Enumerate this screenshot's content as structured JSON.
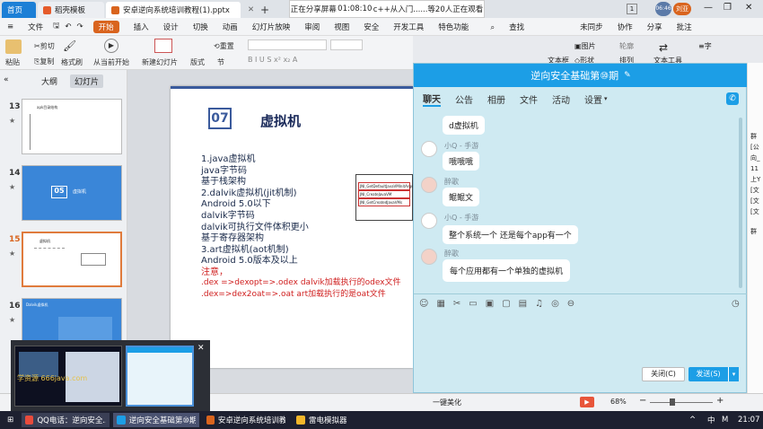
{
  "tabs": {
    "home": "首页",
    "template": "稻壳模板",
    "file": "安卓逆向系统培训教程(1).pptx",
    "new": "+"
  },
  "share": {
    "status": "正在分享屏幕",
    "time": "01:08:10",
    "watching": "c++从入门......等20人正在观看"
  },
  "window_controls": {
    "badge": "1",
    "timer": "06:46",
    "user": "刘亚",
    "minimize": "—",
    "restore": "❐",
    "close": "✕"
  },
  "menu": {
    "file": "文件",
    "start": "开始",
    "items": [
      "插入",
      "设计",
      "切换",
      "动画",
      "幻灯片放映",
      "审阅",
      "视图",
      "安全",
      "开发工具",
      "特色功能"
    ],
    "search": "查找",
    "sync": "未同步",
    "collab": "协作",
    "share": "分享",
    "annotate": "批注"
  },
  "ribbon": {
    "paste": "粘贴",
    "cut": "剪切",
    "copy": "复制",
    "format_painter": "格式刷",
    "play_from_current": "从当前开始",
    "new_slide": "新建幻灯片",
    "layout": "版式",
    "section": "节",
    "reset": "重置",
    "picture": "图片",
    "textbox": "文本框",
    "shape": "形状",
    "arrange": "排列",
    "outline": "轮廓",
    "text_tools": "文本工具",
    "ribbon_right": "≡字"
  },
  "left_panel": {
    "outline_tab": "大纲",
    "slides_tab": "幻灯片",
    "slides": [
      {
        "num": "13",
        "title": "apk目录结构"
      },
      {
        "num": "14",
        "title": "虚拟机",
        "chapter": "05"
      },
      {
        "num": "15",
        "title": "虚拟机"
      },
      {
        "num": "16",
        "title": "Dalvik虚拟机"
      }
    ]
  },
  "slide": {
    "number": "07",
    "title": "虚拟机",
    "lines": [
      "1.java虚拟机",
      "java字节码",
      "基于栈架构",
      "2.dalvik虚拟机(jit机制)",
      "Android 5.0以下",
      "dalvik字节码",
      "dalvik可执行文件体积更小",
      "基于寄存器架构",
      "3.art虚拟机(aot机制)",
      "Android 5.0版本及以上"
    ],
    "note_label": "注意，",
    "red_lines": [
      ".dex =>dexopt=>.odex  dalvik加载执行的odex文件",
      ".dex=>dex2oat=>.oat   art加载执行的是oat文件"
    ],
    "diagram_rows": [
      "JNI_GetDefaultJavaVMInitArgs",
      "JNI_CreateJavaVM",
      "JNI_GetCreatedJavaVMs"
    ]
  },
  "chat": {
    "title": "逆向安全基础第⑩期",
    "tabs": [
      "聊天",
      "公告",
      "相册",
      "文件",
      "活动",
      "设置"
    ],
    "messages": [
      {
        "nick": "",
        "text": "d虚拟机"
      },
      {
        "nick": "小Q - 手游",
        "text": "哦哦哦"
      },
      {
        "nick": "醉歌",
        "text": "鲲鲲文"
      },
      {
        "nick": "小Q - 手游",
        "text": "整个系统一个 还是每个app有一个"
      },
      {
        "nick": "醉歌",
        "text": "每个应用都有一个单独的虚拟机"
      }
    ],
    "close_button": "关闭(C)",
    "send_button": "发送(S)"
  },
  "right_strip": {
    "items": [
      "群",
      "[公",
      "向_",
      "11",
      "上Y",
      "[文",
      "[文",
      "[文",
      "群"
    ]
  },
  "preview": {
    "watermark": "学资源 666java.com",
    "close": "✕"
  },
  "statusbar": {
    "beautify": "一键美化",
    "zoom": "68%",
    "minus": "−",
    "plus": "+"
  },
  "taskbar": {
    "items": [
      "QQ电话：逆向安全...",
      "逆向安全基础第⑩期",
      "安卓逆向系统培训教...",
      "雷电模拟器"
    ],
    "ime": "中",
    "time": "21:07"
  }
}
